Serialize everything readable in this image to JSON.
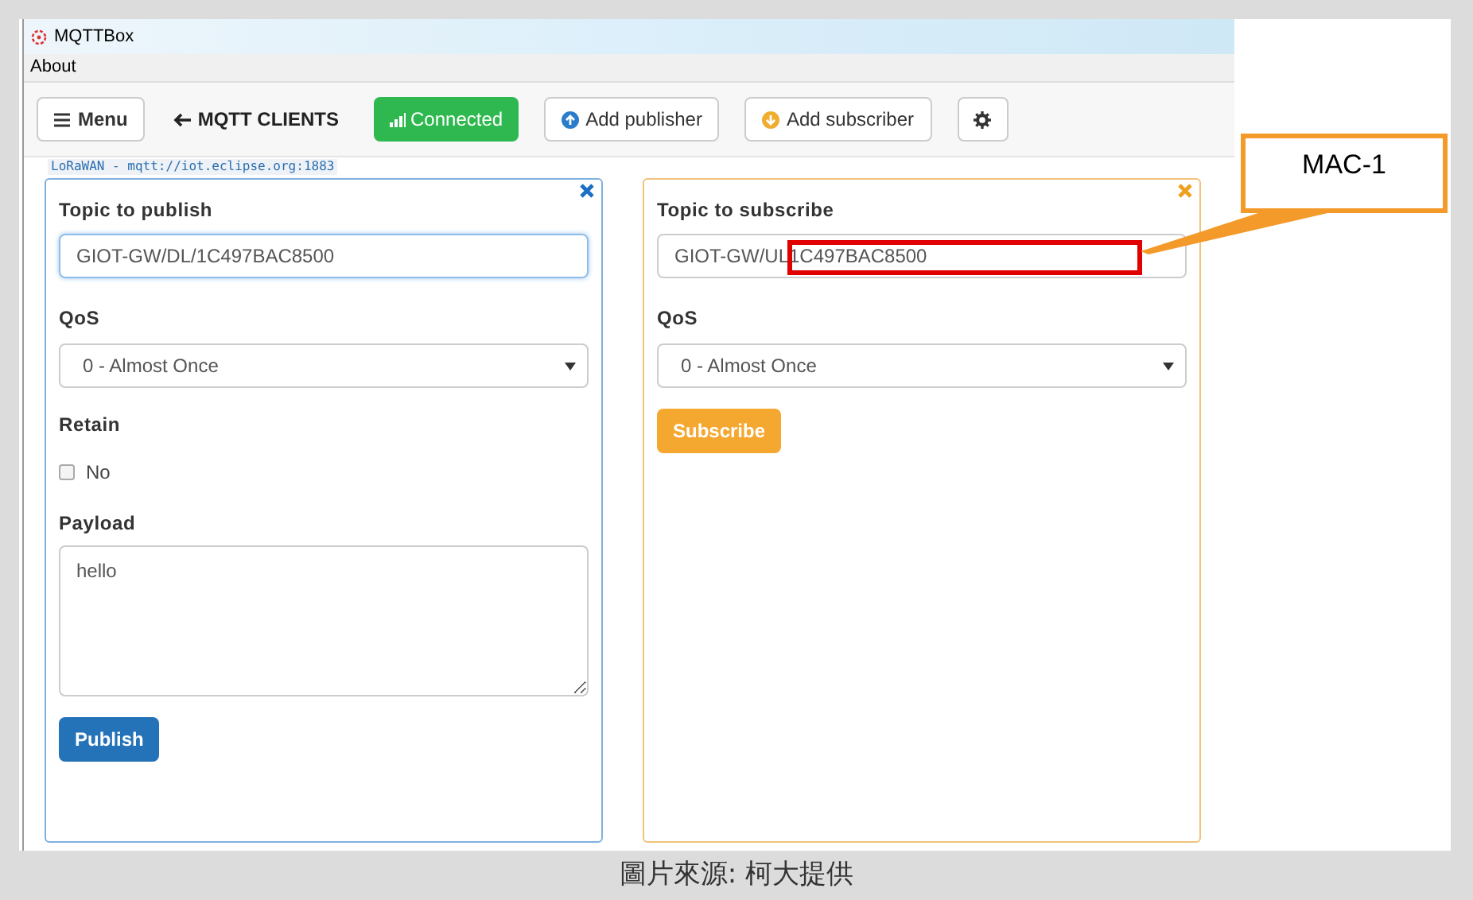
{
  "window": {
    "title": "MQTTBox"
  },
  "menu_bar": [
    "About"
  ],
  "toolbar": {
    "menu_button": "Menu",
    "back_link": "MQTT CLIENTS",
    "status": {
      "label": "Connected",
      "connected": true
    },
    "add_publisher": "Add publisher",
    "add_subscriber": "Add subscriber"
  },
  "connection_label": "LoRaWAN - mqtt://iot.eclipse.org:1883",
  "publisher": {
    "topic_label": "Topic to publish",
    "topic": "GIOT-GW/DL/1C497BAC8500",
    "qos_label": "QoS",
    "qos": "0 - Almost Once",
    "retain_label": "Retain",
    "retain": {
      "label": "No",
      "checked": false
    },
    "payload_label": "Payload",
    "payload": "hello",
    "button": "Publish"
  },
  "subscriber": {
    "topic_label": "Topic to subscribe",
    "topic": "GIOT-GW/UL1C497BAC8500",
    "qos_label": "QoS",
    "qos": "0 - Almost Once",
    "button": "Subscribe"
  },
  "annotation": {
    "label": "MAC-1"
  },
  "caption": "圖片來源: 柯大提供"
}
